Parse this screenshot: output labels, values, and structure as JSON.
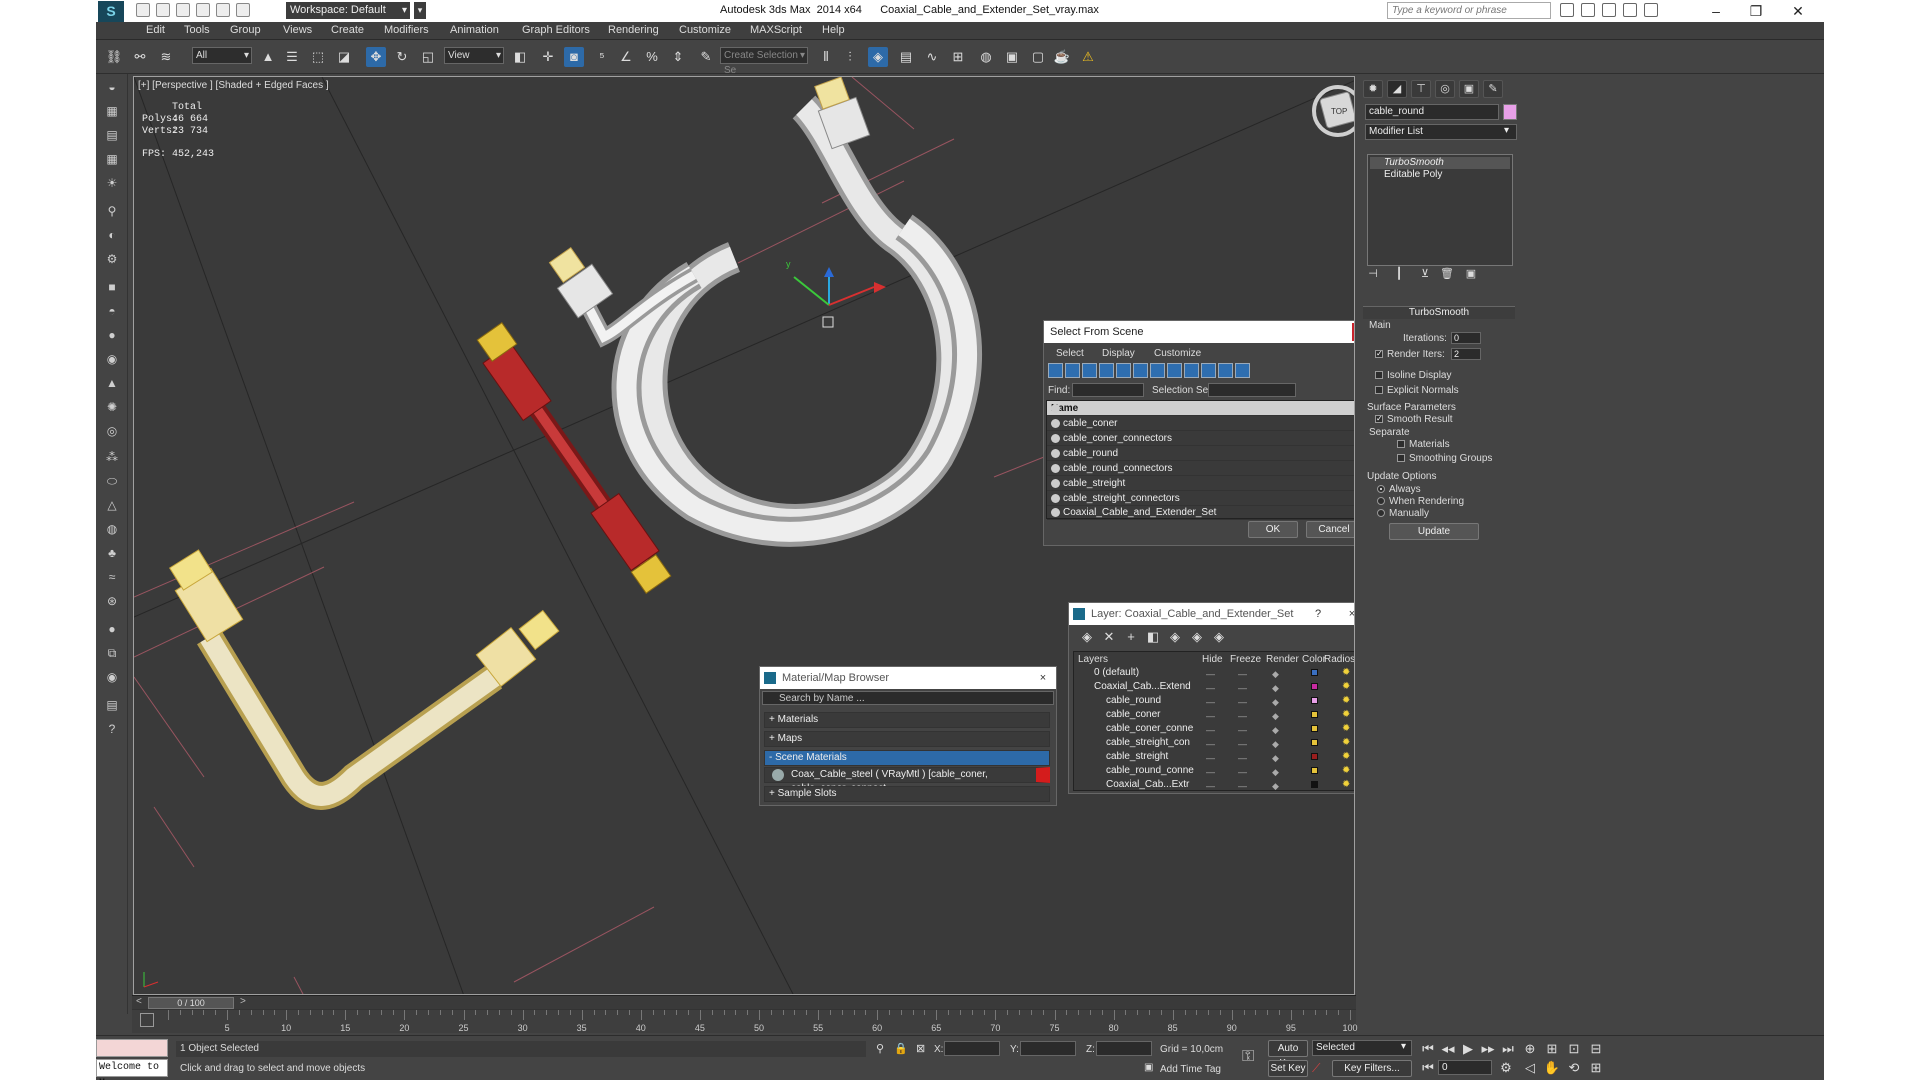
{
  "titlebar": {
    "workspace": "Workspace: Default",
    "app_title": "Autodesk 3ds Max  2014 x64",
    "file_name": "Coaxial_Cable_and_Extender_Set_vray.max",
    "search_placeholder": "Type a keyword or phrase"
  },
  "menu": [
    "Edit",
    "Tools",
    "Group",
    "Views",
    "Create",
    "Modifiers",
    "Animation",
    "Graph Editors",
    "Rendering",
    "Customize",
    "MAXScript",
    "Help"
  ],
  "toolbar": {
    "filter_value": "All",
    "refcoord_value": "View",
    "named_selection_placeholder": "Create Selection Se"
  },
  "viewport": {
    "label": "[+] [Perspective ] [Shaded + Edged Faces ]",
    "stats": {
      "total_label": "Total",
      "polys_label": "Polys:",
      "polys_value": "46 664",
      "verts_label": "Verts:",
      "verts_value": "23 734",
      "fps_label": "FPS:",
      "fps_value": "452,243"
    },
    "gizmo_label": "TOP"
  },
  "command_panel": {
    "object_name": "cable_round",
    "object_color": "#e8a0e8",
    "modifier_list": "Modifier List",
    "stack": [
      "TurboSmooth",
      "Editable Poly"
    ],
    "turbosmooth": {
      "title": "TurboSmooth",
      "main": "Main",
      "iterations_label": "Iterations:",
      "iterations_value": "0",
      "render_iters_label": "Render Iters:",
      "render_iters_value": "2",
      "isoline": "Isoline Display",
      "explicit_normals": "Explicit Normals",
      "surface_params": "Surface Parameters",
      "smooth_result": "Smooth Result",
      "separate": "Separate",
      "materials": "Materials",
      "smoothing_groups": "Smoothing Groups",
      "update_options": "Update Options",
      "always": "Always",
      "when_rendering": "When Rendering",
      "manually": "Manually",
      "update_button": "Update"
    }
  },
  "select_from_scene": {
    "title": "Select From Scene",
    "close": "×",
    "menu": [
      "Select",
      "Display",
      "Customize"
    ],
    "find_label": "Find:",
    "selection_set_label": "Selection Set:",
    "column_name": "Name",
    "items": [
      "cable_coner",
      "cable_coner_connectors",
      "cable_round",
      "cable_round_connectors",
      "cable_streight",
      "cable_streight_connectors",
      "Coaxial_Cable_and_Extender_Set"
    ],
    "ok": "OK",
    "cancel": "Cancel"
  },
  "material_browser": {
    "title": "Material/Map Browser",
    "close": "×",
    "search_placeholder": "Search by Name ...",
    "groups": [
      "+ Materials",
      "+ Maps",
      "- Scene Materials",
      "+ Sample Slots"
    ],
    "material_entry": "Coax_Cable_steel  ( VRayMtl )  [cable_coner, cable_coner_connect..."
  },
  "layer_dialog": {
    "title": "Layer: Coaxial_Cable_and_Extender_Set",
    "help": "?",
    "close": "×",
    "columns": [
      "Layers",
      "Hide",
      "Freeze",
      "Render",
      "Color",
      "Radiosity"
    ],
    "rows": [
      {
        "name": "0 (default)",
        "color": "#3a6fc0"
      },
      {
        "name": "Coaxial_Cab...Extend",
        "color": "#c82aa0"
      },
      {
        "name": "cable_round",
        "color": "#e8a0e8"
      },
      {
        "name": "cable_coner",
        "color": "#e4c23a"
      },
      {
        "name": "cable_coner_conne",
        "color": "#e4c23a"
      },
      {
        "name": "cable_streight_con",
        "color": "#e4c23a"
      },
      {
        "name": "cable_streight",
        "color": "#9a1e1e"
      },
      {
        "name": "cable_round_conne",
        "color": "#e4c23a"
      },
      {
        "name": "Coaxial_Cab...Extr",
        "color": "#111111"
      }
    ]
  },
  "timeline": {
    "frame_counter": "0 / 100",
    "ticks": [
      "5",
      "10",
      "15",
      "20",
      "25",
      "30",
      "35",
      "40",
      "45",
      "50",
      "55",
      "60",
      "65",
      "70",
      "75",
      "80",
      "85",
      "90",
      "95",
      "100"
    ]
  },
  "status": {
    "welcome": "Welcome to M",
    "selection": "1 Object Selected",
    "prompt": "Click and drag to select and move objects",
    "x_label": "X:",
    "y_label": "Y:",
    "z_label": "Z:",
    "grid": "Grid = 10,0cm",
    "add_time_tag": "Add Time Tag",
    "auto_key": "Auto Key",
    "set_key": "Set Key",
    "selected_dropdown": "Selected",
    "key_filters": "Key Filters...",
    "frame_field": "0"
  }
}
